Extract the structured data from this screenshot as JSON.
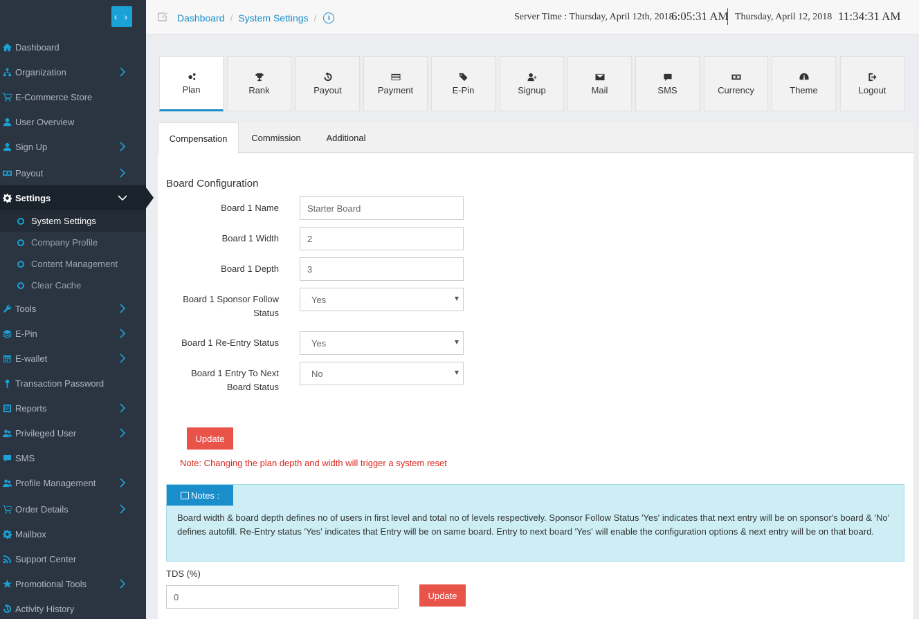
{
  "sidebar": {
    "toggle_label": "‹ ›",
    "items": [
      {
        "label": "Dashboard",
        "icon": "home-icon",
        "arrow": false
      },
      {
        "label": "Organization",
        "icon": "sitemap-icon",
        "arrow": true
      },
      {
        "label": "E-Commerce Store",
        "icon": "cart-icon",
        "arrow": false
      },
      {
        "label": "User Overview",
        "icon": "user-icon",
        "arrow": false
      },
      {
        "label": "Sign Up",
        "icon": "user-icon",
        "arrow": true
      },
      {
        "label": "Payout",
        "icon": "money-icon",
        "arrow": true
      },
      {
        "label": "Settings",
        "icon": "gear-icon",
        "arrow": true,
        "active": true
      },
      {
        "label": "Tools",
        "icon": "wrench-icon",
        "arrow": true
      },
      {
        "label": "E-Pin",
        "icon": "layers-icon",
        "arrow": true
      },
      {
        "label": "E-wallet",
        "icon": "calendar-icon",
        "arrow": true
      },
      {
        "label": "Transaction Password",
        "icon": "key-icon",
        "arrow": false
      },
      {
        "label": "Reports",
        "icon": "report-icon",
        "arrow": true
      },
      {
        "label": "Privileged User",
        "icon": "users-icon",
        "arrow": true
      },
      {
        "label": "SMS",
        "icon": "chat-icon",
        "arrow": false
      },
      {
        "label": "Profile Management",
        "icon": "users-icon",
        "arrow": true
      },
      {
        "label": "Order Details",
        "icon": "cart-icon",
        "arrow": true
      },
      {
        "label": "Mailbox",
        "icon": "gear-icon",
        "arrow": false
      },
      {
        "label": "Support Center",
        "icon": "rss-icon",
        "arrow": false
      },
      {
        "label": "Promotional Tools",
        "icon": "star-icon",
        "arrow": true
      },
      {
        "label": "Activity History",
        "icon": "history-icon",
        "arrow": false
      }
    ],
    "settings_sub": [
      {
        "label": "System Settings",
        "active": true
      },
      {
        "label": "Company Profile"
      },
      {
        "label": "Content Management"
      },
      {
        "label": "Clear Cache"
      }
    ]
  },
  "topbar": {
    "breadcrumb": [
      "Dashboard",
      "System Settings"
    ],
    "server_time_label": "Server Time : Thursday, April 12th, 2018",
    "server_time": "6:05:31 AM",
    "local_date": "Thursday, April 12, 2018",
    "local_time": "11:34:31 AM"
  },
  "toolbar": [
    {
      "label": "Plan",
      "icon": "cogs-icon",
      "active": true
    },
    {
      "label": "Rank",
      "icon": "trophy-icon"
    },
    {
      "label": "Payout",
      "icon": "history-icon"
    },
    {
      "label": "Payment",
      "icon": "credit-card-icon"
    },
    {
      "label": "E-Pin",
      "icon": "tags-icon"
    },
    {
      "label": "Signup",
      "icon": "user-plus-icon"
    },
    {
      "label": "Mail",
      "icon": "envelope-icon"
    },
    {
      "label": "SMS",
      "icon": "chat-icon"
    },
    {
      "label": "Currency",
      "icon": "money-icon"
    },
    {
      "label": "Theme",
      "icon": "dashboard-icon"
    },
    {
      "label": "Logout",
      "icon": "sign-out-icon"
    }
  ],
  "tabs": [
    "Compensation",
    "Commission",
    "Additional"
  ],
  "board": {
    "title": "Board Configuration",
    "name_label": "Board 1 Name",
    "name_value": "Starter Board",
    "width_label": "Board 1 Width",
    "width_value": "2",
    "depth_label": "Board 1 Depth",
    "depth_value": "3",
    "sponsor_label_1": "Board 1 Sponsor Follow",
    "sponsor_label_2": "Status",
    "sponsor_value": "Yes",
    "reentry_label": "Board 1 Re-Entry Status",
    "reentry_value": "Yes",
    "next_label_1": "Board 1 Entry To Next",
    "next_label_2": "Board Status",
    "next_value": "No",
    "update_label": "Update",
    "warning": "Note: Changing the plan depth and width will trigger a system reset"
  },
  "notes": {
    "tag": "Notes :",
    "text": "Board width & board depth defines no of users in first level and total no of levels respectively. Sponsor Follow Status 'Yes' indicates that next entry will be on sponsor's board & 'No' defines autofill. Re-Entry status 'Yes' indicates that Entry will be on same board. Entry to next board 'Yes' will enable the configuration options & next entry will be on that board."
  },
  "tds": {
    "label": "TDS (%)",
    "value": "0",
    "update_label": "Update"
  }
}
